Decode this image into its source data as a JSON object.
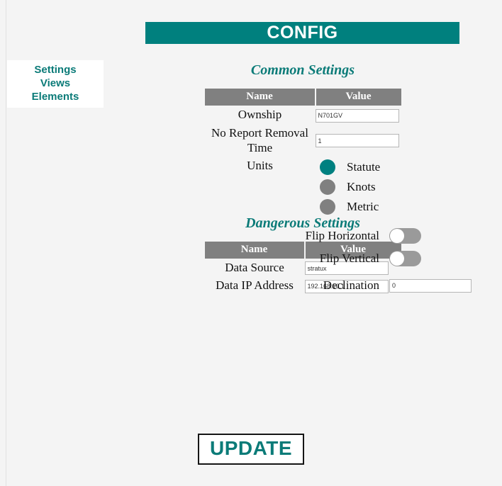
{
  "header": {
    "title": "CONFIG"
  },
  "nav": {
    "items": [
      {
        "label": "Settings"
      },
      {
        "label": "Views"
      },
      {
        "label": "Elements"
      }
    ]
  },
  "common": {
    "title": "Common Settings",
    "columns": {
      "name": "Name",
      "value": "Value"
    },
    "rows": [
      {
        "name": "Ownship",
        "value": "N701GV"
      },
      {
        "name": "No Report Removal Time",
        "value": "1"
      },
      {
        "name": "Units"
      }
    ],
    "units": {
      "options": [
        {
          "label": "Statute",
          "selected": true
        },
        {
          "label": "Knots",
          "selected": false
        },
        {
          "label": "Metric",
          "selected": false
        }
      ]
    },
    "toggles": [
      {
        "label": "Flip Horizontal",
        "state": "off"
      },
      {
        "label": "Flip Vertical",
        "state": "off"
      }
    ],
    "declination": {
      "label": "Declination",
      "value": "0"
    }
  },
  "dangerous": {
    "title": "Dangerous Settings",
    "columns": {
      "name": "Name",
      "value": "Value"
    },
    "rows": [
      {
        "name": "Data Source",
        "value": "stratux"
      },
      {
        "name": "Data IP Address",
        "value": "192.168.10.1"
      }
    ]
  },
  "actions": {
    "update_label": "UPDATE"
  },
  "colors": {
    "teal": "#008080",
    "teal_text": "#0b7b78",
    "table_header_gray": "#808080",
    "toggle_gray": "#9a9a9a",
    "background": "#f4f4f4"
  }
}
